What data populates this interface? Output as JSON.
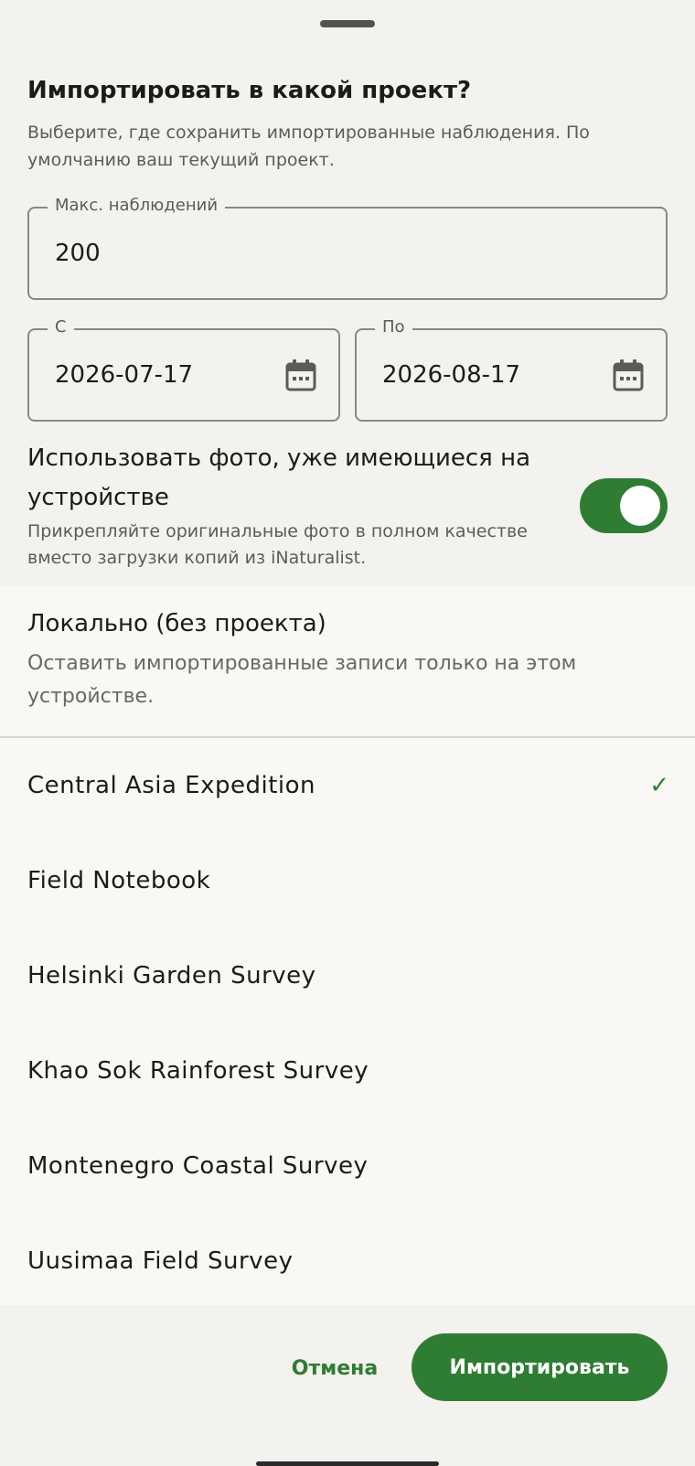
{
  "dialog": {
    "title": "Импортировать в какой проект?",
    "subtitle": "Выберите, где сохранить импортированные наблюдения. По умолчанию ваш текущий проект."
  },
  "max_observations": {
    "label": "Макс. наблюдений",
    "value": "200"
  },
  "date_from": {
    "label": "С",
    "value": "2026-07-17",
    "icon": "calendar-icon"
  },
  "date_to": {
    "label": "По",
    "value": "2026-08-17",
    "icon": "calendar-icon"
  },
  "use_device_photos": {
    "title": "Использовать фото, уже имеющиеся на устройстве",
    "description": "Прикрепляйте оригинальные фото в полном качестве вместо загрузки копий из iNaturalist.",
    "enabled": true
  },
  "local_option": {
    "title": "Локально (без проекта)",
    "description": "Оставить импортированные записи только на этом устройстве."
  },
  "projects": [
    {
      "label": "Central Asia Expedition",
      "selected": true
    },
    {
      "label": "Field Notebook",
      "selected": false
    },
    {
      "label": "Helsinki Garden Survey",
      "selected": false
    },
    {
      "label": "Khao Sok Rainforest Survey",
      "selected": false
    },
    {
      "label": "Montenegro Coastal Survey",
      "selected": false
    },
    {
      "label": "Uusimaa Field Survey",
      "selected": false
    }
  ],
  "check_glyph": "✓",
  "buttons": {
    "cancel": "Отмена",
    "import": "Импортировать"
  },
  "colors": {
    "accent": "#2e7d32",
    "background": "#f3f2ee",
    "list_background": "#f9f8f5"
  }
}
